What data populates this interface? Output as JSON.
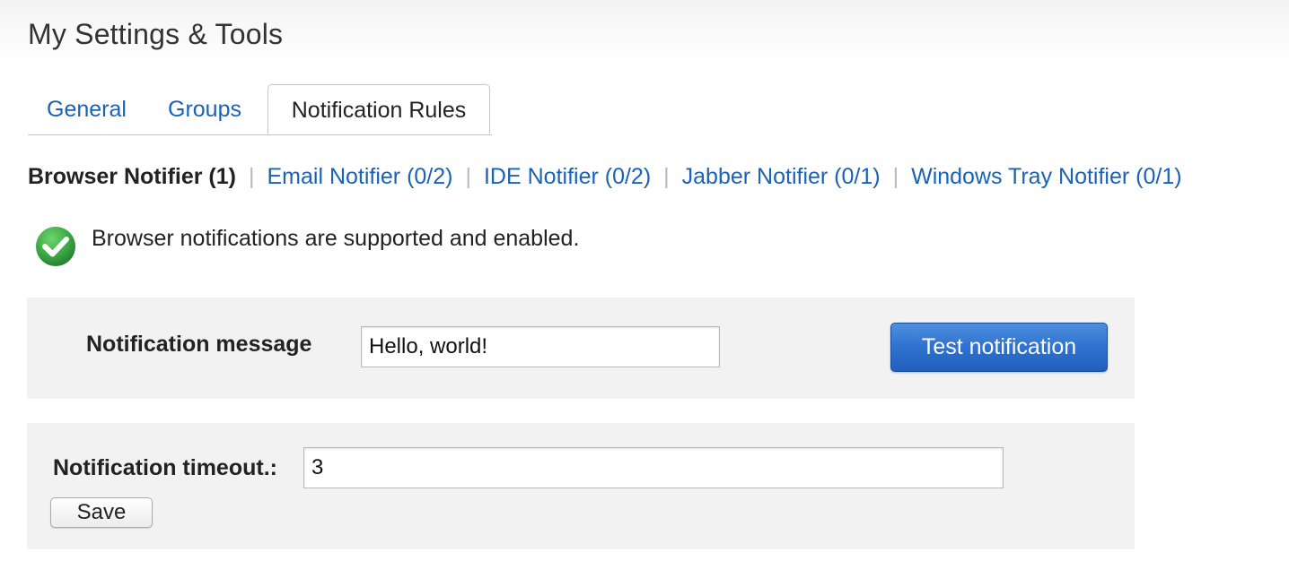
{
  "page": {
    "title": "My Settings & Tools"
  },
  "tabs": [
    {
      "label": "General",
      "active": false
    },
    {
      "label": "Groups",
      "active": false
    },
    {
      "label": "Notification Rules",
      "active": true
    }
  ],
  "subnav": {
    "current": "Browser Notifier (1)",
    "separator": "|",
    "links": [
      {
        "label": "Email Notifier (0/2)"
      },
      {
        "label": "IDE Notifier (0/2)"
      },
      {
        "label": "Jabber Notifier (0/1)"
      },
      {
        "label": "Windows Tray Notifier (0/1)"
      }
    ]
  },
  "status": {
    "icon": "check-circle-icon",
    "text": "Browser notifications are supported and enabled.",
    "color": "#3aa745"
  },
  "message_panel": {
    "label": "Notification message",
    "value": "Hello, world!",
    "button_label": "Test notification"
  },
  "timeout_panel": {
    "label": "Notification timeout.:",
    "value": "3",
    "save_label": "Save"
  },
  "colors": {
    "link": "#1a62b8",
    "primary_button": "#2f72cf",
    "panel_bg": "#f2f2f2"
  }
}
